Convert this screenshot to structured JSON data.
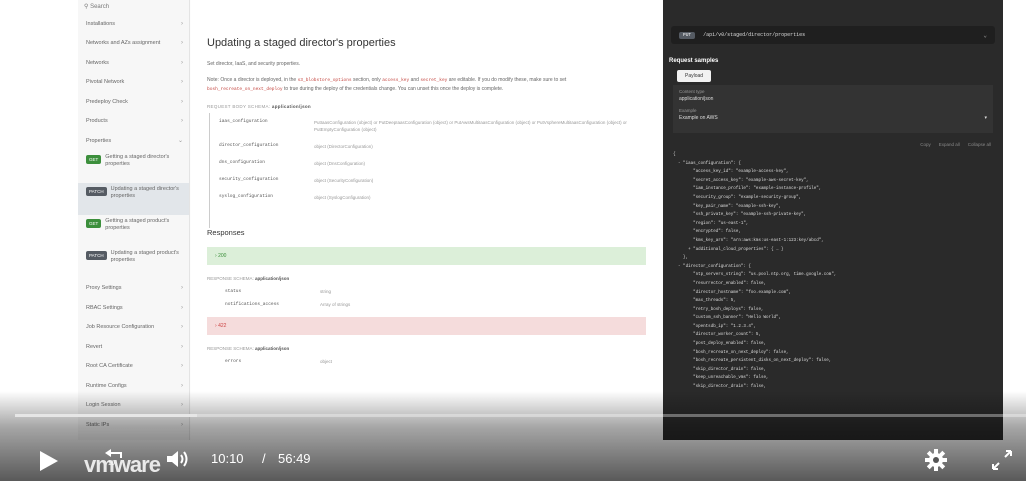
{
  "sidebar": {
    "search_placeholder": "Search",
    "items": [
      {
        "label": "Installations"
      },
      {
        "label": "Networks and AZs assignment"
      },
      {
        "label": "Networks"
      },
      {
        "label": "Pivotal Network"
      },
      {
        "label": "Predeploy Check"
      },
      {
        "label": "Products"
      },
      {
        "label": "Properties"
      }
    ],
    "sub_items": [
      {
        "method": "GET",
        "label": "Getting a staged director's properties"
      },
      {
        "method": "PATCH",
        "label": "Updating a staged director's properties"
      },
      {
        "method": "GET",
        "label": "Getting a staged product's properties"
      },
      {
        "method": "PATCH",
        "label": "Updating a staged product's properties"
      }
    ],
    "items_after": [
      {
        "label": "Proxy Settings"
      },
      {
        "label": "RBAC Settings"
      },
      {
        "label": "Job Resource Configuration"
      },
      {
        "label": "Revert"
      },
      {
        "label": "Root CA Certificate"
      },
      {
        "label": "Runtime Configs"
      },
      {
        "label": "Login Session"
      },
      {
        "label": "Static IPs"
      }
    ],
    "chevron": "›",
    "chevron_down": "⌄"
  },
  "main": {
    "title": "Updating a staged director's properties",
    "description": "Set director, IaaS, and security properties.",
    "note_before": "Note: Once a director is deployed, in the",
    "note_code1": "s3_blobstore_options",
    "note_mid1": "section, only",
    "note_code2": "access_key",
    "note_mid2": "and",
    "note_code3": "secret_key",
    "note_mid3": "are editable. If you do modify these, make sure to set",
    "note_code4": "bosh_recreate_on_next_deploy",
    "note_after": "to true during the deploy of the credentials change. You can unset this once the deploy is complete.",
    "schema_label": "REQUEST BODY SCHEMA:",
    "schema_type": "application/json",
    "properties": [
      {
        "name": "iaas_configuration",
        "req": "",
        "desc": "PutIaasConfiguration (object) or PutDeepIaasConfiguration (object) or PutAwsMultiIaasConfiguration (object) or PutVsphereMultiIaasConfiguration (object) or PutEmptyConfiguration (object)"
      },
      {
        "name": "director_configuration",
        "req": "",
        "desc": "object (DirectorConfiguration)"
      },
      {
        "name": "dns_configuration",
        "req": "",
        "desc": "object (DnsConfiguration)"
      },
      {
        "name": "security_configuration",
        "req": "",
        "desc": "object (SecurityConfiguration)"
      },
      {
        "name": "syslog_configuration",
        "req": "",
        "desc": "object (SyslogConfiguration)"
      }
    ],
    "responses_title": "Responses",
    "resp_ok": "200",
    "resp_bad": "422",
    "resp_schema_label": "RESPONSE SCHEMA:",
    "resp_schema_type": "application/json",
    "resp_props": [
      {
        "name": "status",
        "type": "string"
      },
      {
        "name": "notifications_access",
        "type": "Array of strings"
      }
    ],
    "resp2_prop": {
      "name": "errors",
      "type": "object"
    }
  },
  "panel": {
    "method": "PUT",
    "endpoint": "/api/v0/staged/director/properties",
    "request_samples": "Request samples",
    "payload_tab": "Payload",
    "content_type_label": "Content type",
    "content_type_value": "application/json",
    "example_label": "Example",
    "example_value": "Example on AWS",
    "copy": "Copy",
    "expand_all": "Expand all",
    "collapse_all": "Collapse all"
  },
  "code": [
    "{",
    "  - \"iaas_configuration\": {",
    "        \"access_key_id\": \"example-access-key\",",
    "        \"secret_access_key\": \"example-aws-secret-key\",",
    "        \"iam_instance_profile\": \"example-instance-profile\",",
    "        \"security_group\": \"example-security-group\",",
    "        \"key_pair_name\": \"example-ssh-key\",",
    "        \"ssh_private_key\": \"example-ssh-private-key\",",
    "        \"region\": \"us-east-1\",",
    "        \"encrypted\": false,",
    "        \"kms_key_arn\": \"arn:aws:kms:us-east-1:123:key/abcd\",",
    "      + \"additional_cloud_properties\": { … }",
    "    },",
    "  - \"director_configuration\": {",
    "        \"ntp_servers_string\": \"us.pool.ntp.org, time.google.com\",",
    "        \"resurrector_enabled\": false,",
    "        \"director_hostname\": \"foo.example.com\",",
    "        \"max_threads\": 5,",
    "        \"retry_bosh_deploys\": false,",
    "        \"custom_ssh_banner\": \"Hello World\",",
    "        \"opentsdb_ip\": \"1.2.3.4\",",
    "        \"director_worker_count\": 5,",
    "        \"post_deploy_enabled\": false,",
    "        \"bosh_recreate_on_next_deploy\": false,",
    "        \"bosh_recreate_persistent_disks_on_next_deploy\": false,",
    "        \"skip_director_drain\": false,",
    "        \"keep_unreachable_vms\": false,",
    "        \"skip_director_drain\": false,"
  ],
  "video": {
    "progress_fraction": 0.18,
    "current_time": "10:10",
    "separator": "/",
    "total_time": "56:49",
    "skip_label": "10",
    "brand": "vmware"
  },
  "colors": {
    "panel_bg": "#2a2a2a",
    "ok_green": "#3c8f3c",
    "error_red": "#c44444"
  }
}
